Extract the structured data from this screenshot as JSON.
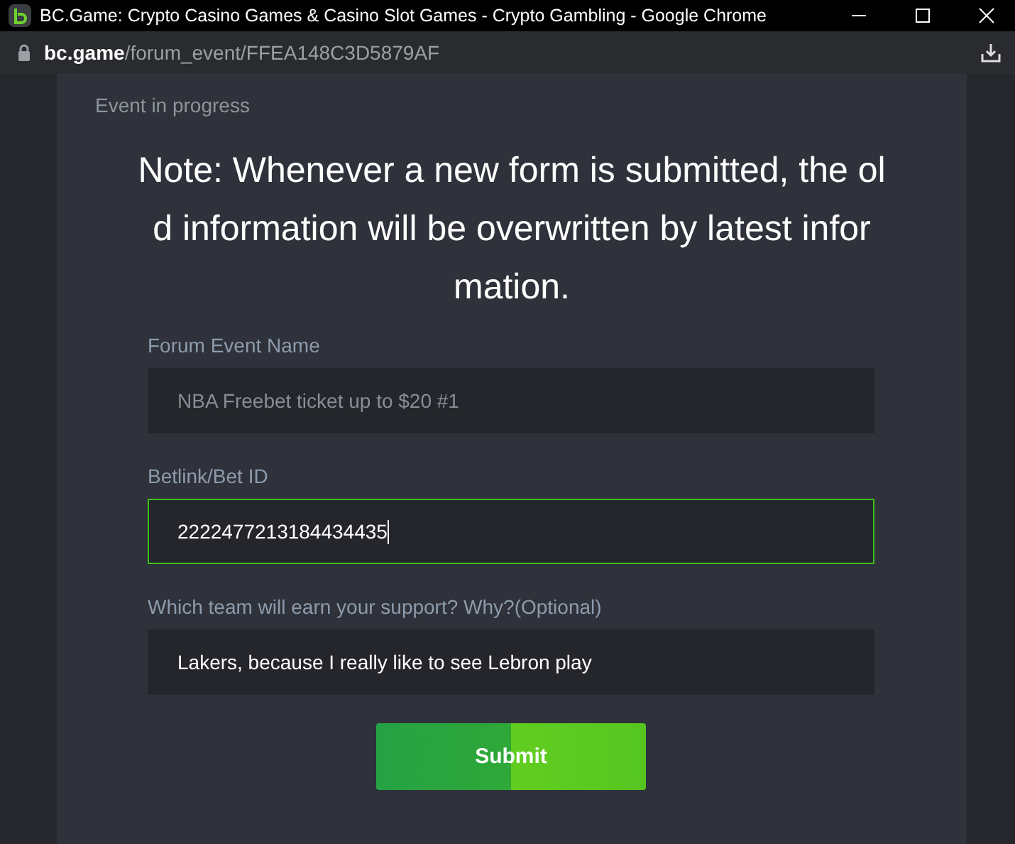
{
  "window": {
    "title": "BC.Game: Crypto Casino Games & Casino Slot Games - Crypto Gambling - Google Chrome"
  },
  "address_bar": {
    "domain": "bc.game",
    "path": "/forum_event/FFEA148C3D5879AF"
  },
  "page": {
    "status": "Event in progress",
    "note_lines": [
      "Note: Whenever a new form is submitted, the ol",
      "d information will be overwritten by latest infor",
      "mation."
    ],
    "fields": [
      {
        "label": "Forum Event Name",
        "value": "NBA Freebet ticket up to $20 #1",
        "disabled": true,
        "focused": false
      },
      {
        "label": "Betlink/Bet ID",
        "value": "2222477213184434435",
        "disabled": false,
        "focused": true
      },
      {
        "label": "Which team will earn your support? Why?(Optional)",
        "value": "Lakers, because I really like to see Lebron play",
        "disabled": false,
        "focused": false
      }
    ],
    "submit": "Submit"
  }
}
